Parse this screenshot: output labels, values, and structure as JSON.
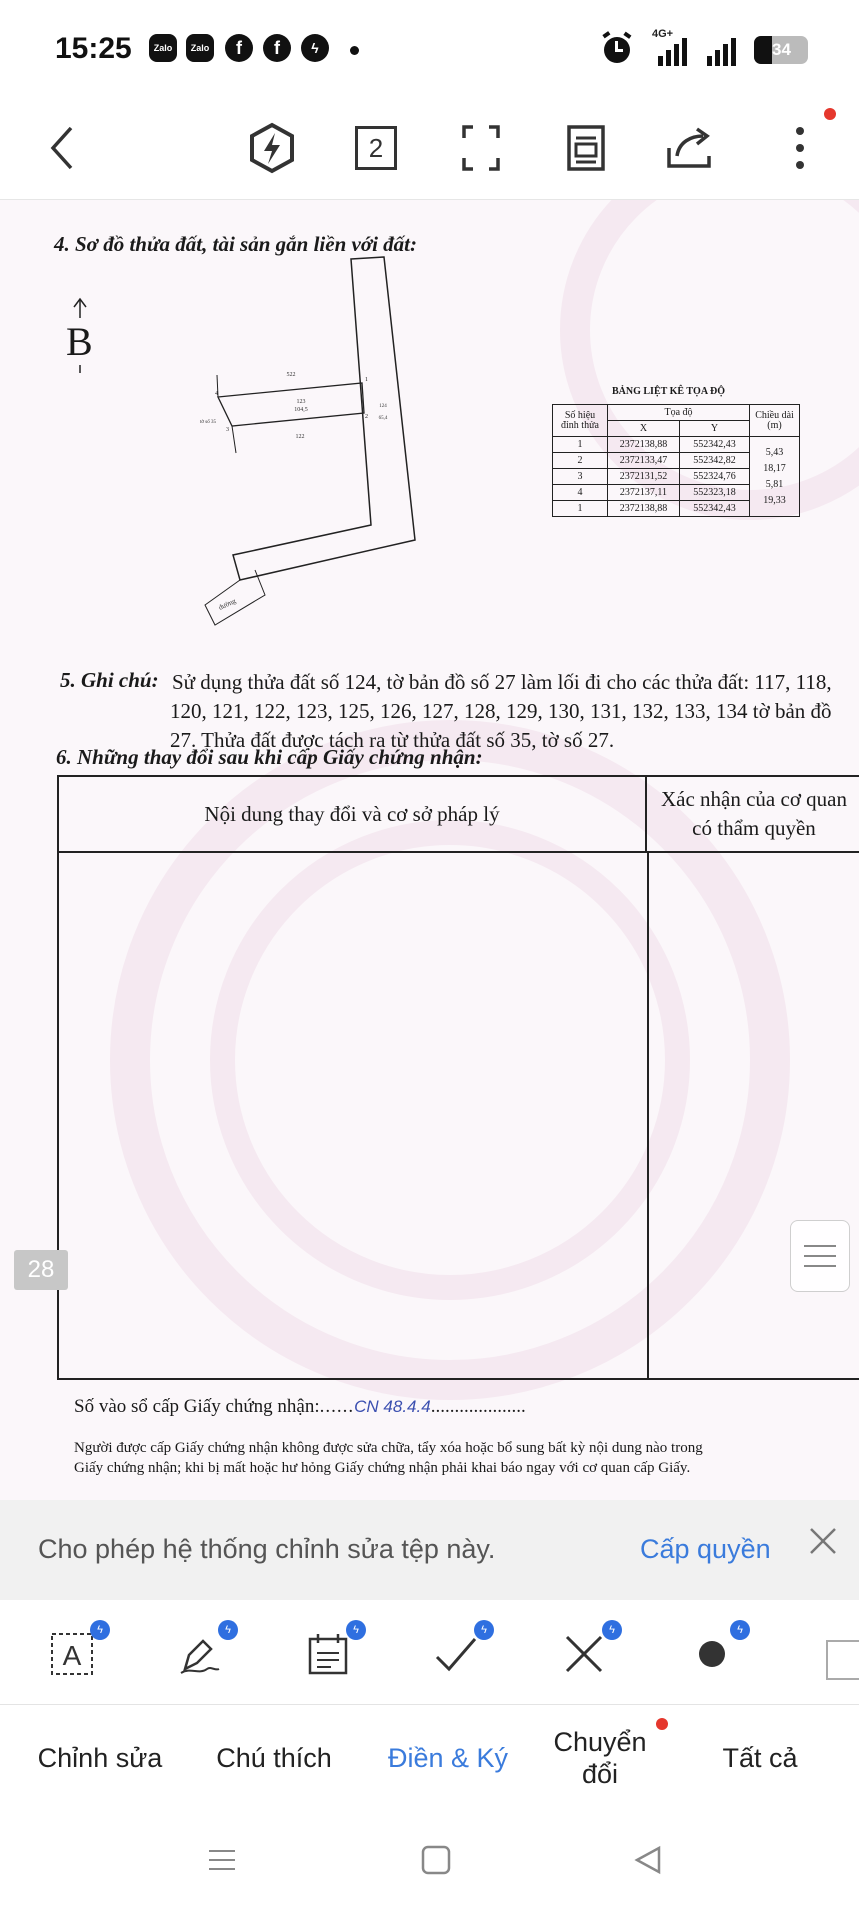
{
  "status_bar": {
    "time": "15:25",
    "apps": [
      "Zalo",
      "Zalo",
      "facebook-icon",
      "facebook-icon",
      "messenger-icon"
    ],
    "network": "4G+",
    "battery": "34"
  },
  "toolbar": {
    "page_count": "2",
    "icons": [
      "back-icon",
      "lightning-icon",
      "page-count-icon",
      "fullscreen-icon",
      "reader-icon",
      "share-icon",
      "more-icon"
    ],
    "notification_color": "#e5372d"
  },
  "document": {
    "section4_heading": "4. Sơ đồ thửa đất, tài sản gắn liền với đất:",
    "north_label": "B",
    "map_labels": {
      "parcel_top": "522",
      "parcel_mid": "123",
      "parcel_mid_area": "104,5",
      "parcel_bottom": "122",
      "left_parcel": "tờ số 35",
      "road_label": "đường",
      "right_parcel": "124",
      "right_parcel_area": "65,4"
    },
    "coord_table": {
      "title": "BẢNG LIỆT KÊ TỌA ĐỘ",
      "header_point": "Số hiệu đỉnh thửa",
      "header_coords": "Tọa độ",
      "header_length": "Chiều dài (m)",
      "col_x": "X",
      "col_y": "Y",
      "rows": [
        {
          "point": "1",
          "x": "2372138,88",
          "y": "552342,43"
        },
        {
          "point": "2",
          "x": "2372133,47",
          "y": "552342,82"
        },
        {
          "point": "3",
          "x": "2372131,52",
          "y": "552324,76"
        },
        {
          "point": "4",
          "x": "2372137,11",
          "y": "552323,18"
        },
        {
          "point": "1",
          "x": "2372138,88",
          "y": "552342,43"
        }
      ],
      "lengths": [
        "5,43",
        "18,17",
        "5,81",
        "19,33"
      ]
    },
    "section5_label": "5. Ghi chú:",
    "section5_line1": "Sử dụng thửa đất số 124, tờ bản đồ số 27 làm lối đi cho các thửa đất: 117, 118,",
    "section5_line2": "120, 121, 122, 123, 125, 126, 127, 128, 129, 130, 131, 132, 133, 134 tờ bản đồ",
    "section5_line3": "27. Thửa đất được tách ra từ thửa đất số 35, tờ số 27.",
    "section6_heading": "6. Những thay đổi sau khi cấp Giấy chứng nhận:",
    "change_table": {
      "col1": "Nội dung thay đổi và cơ sở pháp lý",
      "col2_line1": "Xác nhận của cơ quan",
      "col2_line2": "có thẩm quyền"
    },
    "cert_number_label": "Số vào sổ cấp Giấy chứng nhận:",
    "cert_number_value": "CN 48.4.4",
    "footer_line1": "Người được cấp Giấy chứng nhận không được sửa chữa, tẩy xóa hoặc bổ sung bất kỳ nội dung nào trong",
    "footer_line2": "Giấy chứng nhận; khi bị mất hoặc hư hỏng Giấy chứng nhận phải khai báo ngay với cơ quan cấp Giấy.",
    "page_number": "28"
  },
  "banner": {
    "message": "Cho phép hệ thống chỉnh sửa tệp này.",
    "grant_label": "Cấp quyền"
  },
  "tools": [
    "text-box-icon",
    "signature-pen-icon",
    "date-icon",
    "checkmark-icon",
    "cross-icon",
    "dot-icon"
  ],
  "tabs": {
    "edit": "Chỉnh sửa",
    "annotate": "Chú thích",
    "fill_sign": "Điền & Ký",
    "convert_line1": "Chuyển",
    "convert_line2": "đổi",
    "all": "Tất cả"
  },
  "colors": {
    "accent": "#3a7bdc",
    "badge": "#2f6fe0",
    "red_dot": "#e5372d"
  }
}
